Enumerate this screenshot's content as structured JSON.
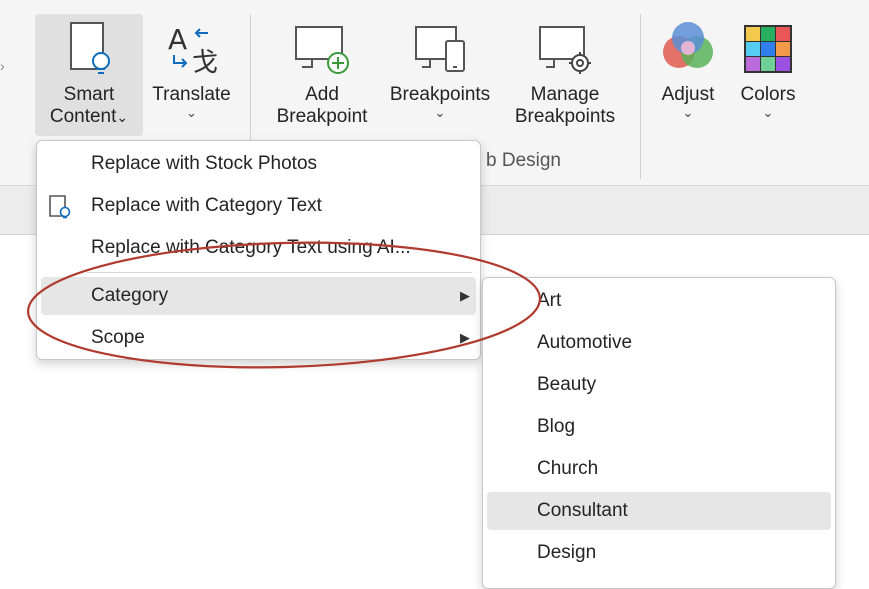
{
  "ribbon": {
    "smart_content": {
      "line1": "Smart",
      "line2": "Content",
      "chevron": "⌄",
      "icon": "document-lightbulb-icon"
    },
    "translate": {
      "label": "Translate",
      "chevron": "⌄",
      "icon": "translate-icon"
    },
    "add_breakpoint": {
      "line1": "Add",
      "line2": "Breakpoint",
      "icon": "monitor-add-icon"
    },
    "breakpoints": {
      "label": "Breakpoints",
      "chevron": "⌄",
      "icon": "monitor-devices-icon"
    },
    "manage_breakpoints": {
      "line1": "Manage",
      "line2": "Breakpoints",
      "icon": "monitor-gear-icon"
    },
    "adjust": {
      "label": "Adjust",
      "chevron": "⌄",
      "icon": "color-circles-icon"
    },
    "colors": {
      "label": "Colors",
      "chevron": "⌄",
      "icon": "color-grid-icon"
    },
    "group_label_partial": "b Design"
  },
  "menu": {
    "items": [
      {
        "label": "Replace with Stock Photos"
      },
      {
        "label": "Replace with Category Text",
        "icon": "document-lightbulb-icon"
      },
      {
        "label": "Replace with Category Text using AI..."
      },
      {
        "label": "Category",
        "arrow": "▶"
      },
      {
        "label": "Scope",
        "arrow": "▶"
      }
    ]
  },
  "submenu": {
    "items": [
      "Art",
      "Automotive",
      "Beauty",
      "Blog",
      "Church",
      "Consultant",
      "Design"
    ],
    "highlighted": "Consultant"
  },
  "colors": {
    "annotation": "#b03a2e",
    "accent": "#0f6cbd",
    "green": "#3a9a3a"
  }
}
